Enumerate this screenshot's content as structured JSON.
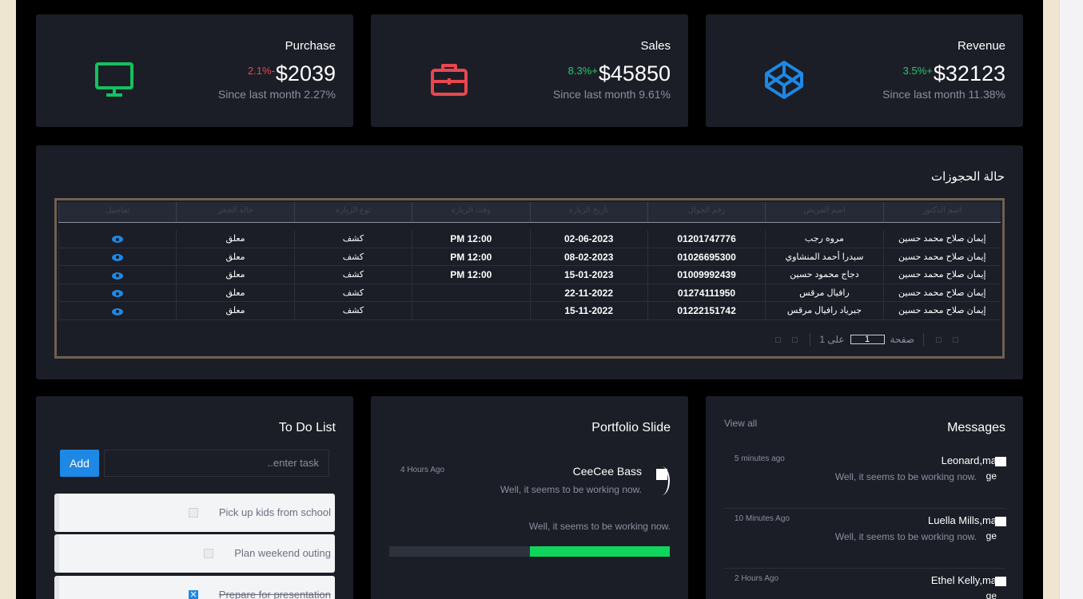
{
  "stats": [
    {
      "title": "Purchase",
      "value": "$2039",
      "change": "2.1%-",
      "change_dir": "down",
      "sub": "Since last month 2.27%",
      "icon": "monitor-icon",
      "icon_color": "#16c060"
    },
    {
      "title": "Sales",
      "value": "$45850",
      "change": "8.3%+",
      "change_dir": "up",
      "sub": "Since last month 9.61%",
      "icon": "briefcase-icon",
      "icon_color": "#e8474e"
    },
    {
      "title": "Revenue",
      "value": "$32123",
      "change": "3.5%+",
      "change_dir": "up",
      "sub": "Since last month 11.38%",
      "icon": "codepen-icon",
      "icon_color": "#1e88e5"
    }
  ],
  "bookings": {
    "title": "حالة الحجوزات",
    "columns": [
      "اسم الدكتور",
      "اسم المريض",
      "رقم الجوال",
      "تاريخ الزيارة",
      "وقت الزيارة",
      "نوع الزيارة",
      "حالة الحجز",
      "تفاصيل"
    ],
    "rows": [
      [
        "إيمان صلاح محمد حسين",
        "مروه رجب",
        "01201747776",
        "02-06-2023",
        "PM 12:00",
        "كشف",
        "معلق"
      ],
      [
        "إيمان صلاح محمد حسين",
        "سيدرا أحمد المنشاوي",
        "01026695300",
        "08-02-2023",
        "PM 12:00",
        "كشف",
        "معلق"
      ],
      [
        "إيمان صلاح محمد حسين",
        "دجاج محمود حسين",
        "01009992439",
        "15-01-2023",
        "PM 12:00",
        "كشف",
        "معلق"
      ],
      [
        "إيمان صلاح محمد حسين",
        "رافيال مرقس",
        "01274111950",
        "22-11-2022",
        "",
        "كشف",
        "معلق"
      ],
      [
        "إيمان صلاح محمد حسين",
        "جبرياد رافيال مرقس",
        "01222151742",
        "15-11-2022",
        "",
        "كشف",
        "معلق"
      ]
    ],
    "pager": {
      "page_label": "صفحة",
      "page_value": "1",
      "of_label": "على 1"
    }
  },
  "todo": {
    "title": "To Do List",
    "add_label": "Add",
    "placeholder": "enter task..",
    "items": [
      {
        "text": "Pick up kids from school",
        "done": false
      },
      {
        "text": "Plan weekend outing",
        "done": false
      },
      {
        "text": "Prepare for presentation",
        "done": true
      }
    ]
  },
  "portfolio": {
    "title": "Portfolio Slide",
    "name": "CeeCee Bass",
    "time": "4 Hours Ago",
    "message": "Well, it seems to be working now.",
    "text": "Well, it seems to be working now.",
    "progress": 0.5,
    "progress_color": "#0fd65b"
  },
  "messages": {
    "title": "Messages",
    "view_all": "View all",
    "items": [
      {
        "name": "Leonard",
        "img_alt": "ma",
        "img_alt2": "ge",
        "text": "Well, it seems to be working now.",
        "time": "5 minutes ago"
      },
      {
        "name": "Luella Mills",
        "img_alt": "ma",
        "img_alt2": "ge",
        "text": "Well, it seems to be working now.",
        "time": "10 Minutes Ago"
      },
      {
        "name": "Ethel Kelly",
        "img_alt": "ma",
        "img_alt2": "ge",
        "text": "",
        "time": "2 Hours Ago"
      }
    ]
  }
}
